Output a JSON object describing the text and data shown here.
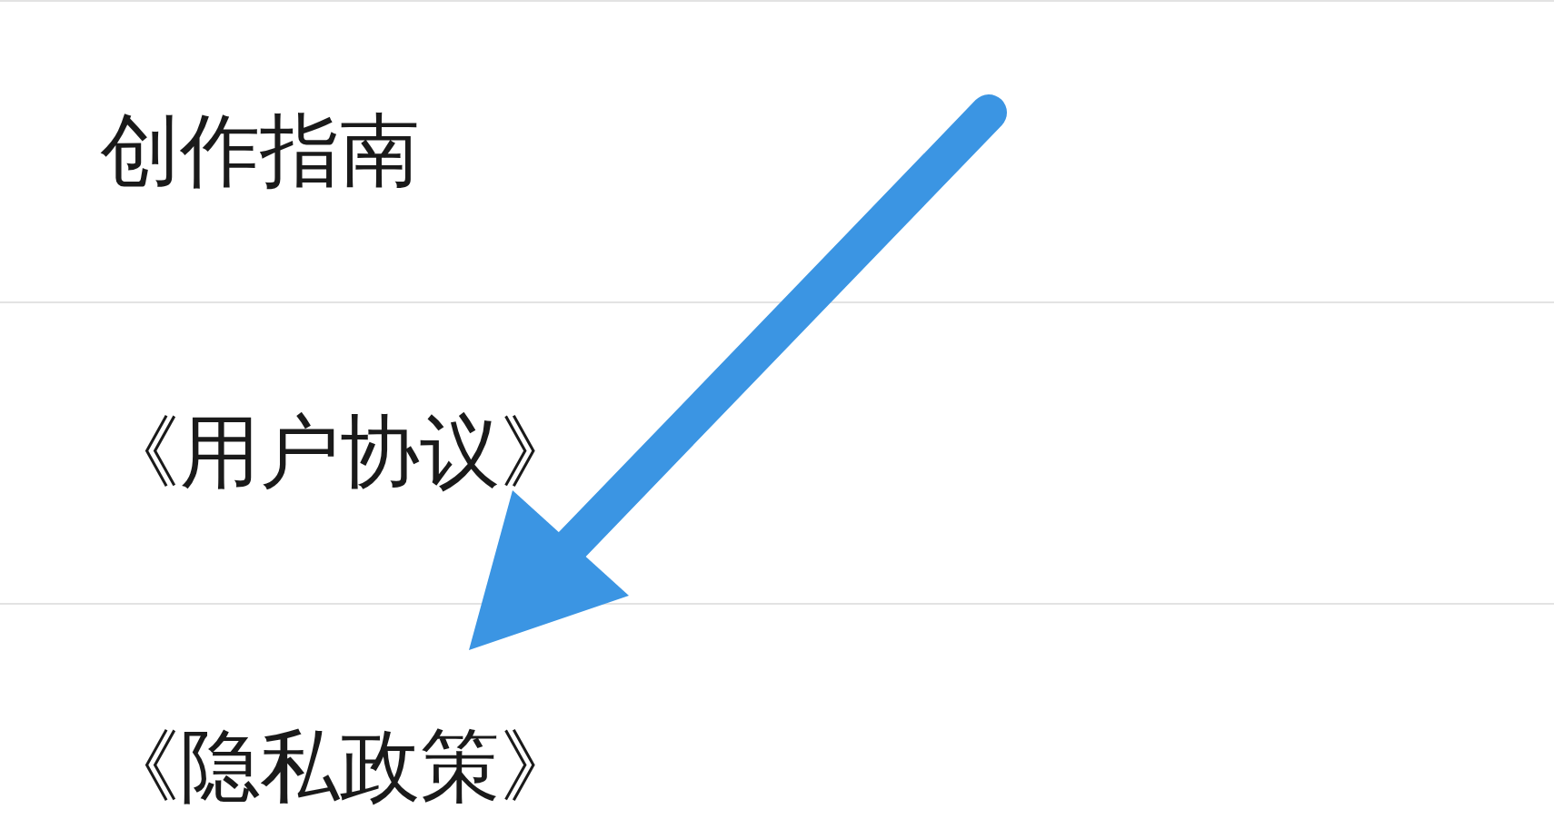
{
  "menu_items": [
    {
      "label": "创作指南"
    },
    {
      "label": "《用户协议》"
    },
    {
      "label": "《隐私政策》"
    }
  ]
}
